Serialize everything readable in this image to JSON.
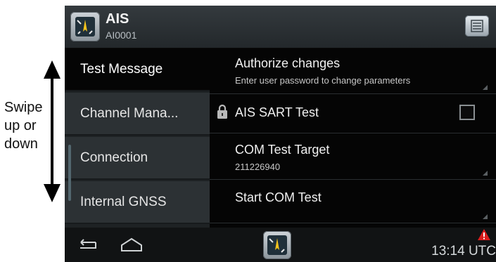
{
  "annotation": {
    "lines": [
      "Swipe",
      "up or",
      "down"
    ]
  },
  "header": {
    "title": "AIS",
    "subtitle": "AI0001",
    "app_icon": "ais-compass-icon",
    "menu_icon": "menu-list-icon"
  },
  "nav": {
    "items": [
      {
        "label": "Test Message",
        "active": true
      },
      {
        "label": "Channel Mana..."
      },
      {
        "label": "Connection"
      },
      {
        "label": "Internal GNSS"
      }
    ]
  },
  "settings": {
    "authorize": {
      "title": "Authorize changes",
      "subtitle": "Enter user password to change parameters"
    },
    "sart": {
      "title": "AIS SART Test",
      "locked": true,
      "checked": false
    },
    "com_target": {
      "title": "COM Test Target",
      "value": "211226940"
    },
    "start_com": {
      "title": "Start COM Test"
    }
  },
  "statusbar": {
    "time": "13:14 UTC",
    "warning_icon": "warning-triangle-icon"
  },
  "colors": {
    "active_nav": "#050505",
    "nav_item": "#2c3134",
    "warning": "#d91c1c"
  }
}
